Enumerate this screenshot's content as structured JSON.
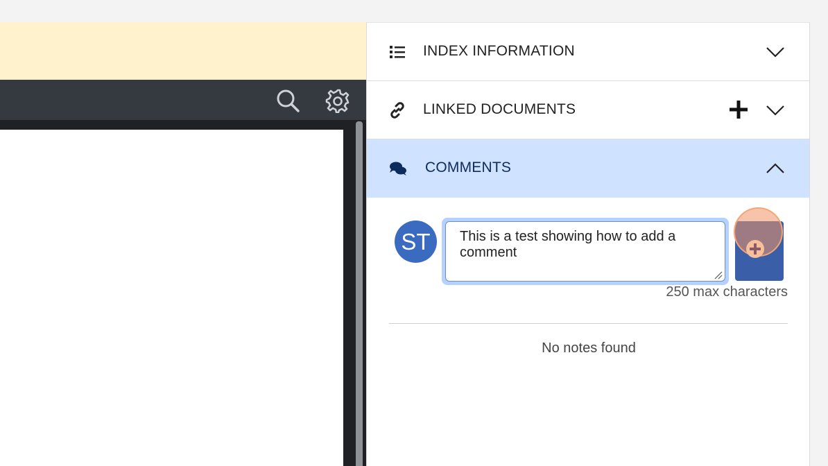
{
  "viewer": {
    "toolbar_icons": [
      "search-icon",
      "gear-icon"
    ]
  },
  "panel": {
    "sections": [
      {
        "title": "INDEX INFORMATION",
        "icon": "list-icon",
        "expanded": false
      },
      {
        "title": "LINKED DOCUMENTS",
        "icon": "link-icon",
        "expanded": false,
        "has_add": true
      },
      {
        "title": "COMMENTS",
        "icon": "comments-icon",
        "expanded": true
      }
    ],
    "comments": {
      "avatar_initials": "ST",
      "input_value": "This is a test showing how to add a comment",
      "max_chars_label": "250 max characters",
      "empty_label": "No notes found"
    }
  },
  "colors": {
    "banner": "#fff2cc",
    "toolbar": "#343a40",
    "active_section": "#cfe2ff",
    "avatar": "#3a6bc0",
    "add_button": "#3a5fa8"
  }
}
